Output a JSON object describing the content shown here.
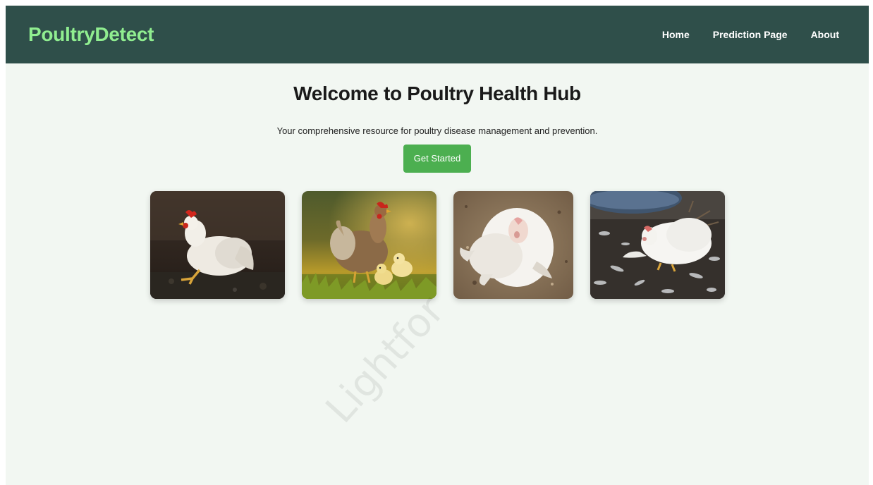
{
  "navbar": {
    "brand": "PoultryDetect",
    "links": [
      "Home",
      "Prediction Page",
      "About"
    ]
  },
  "hero": {
    "title": "Welcome to Poultry Health Hub",
    "subtitle": "Your comprehensive resource for poultry disease management and prevention.",
    "cta_label": "Get Started"
  },
  "gallery": {
    "images": [
      "white-hen-sitting-photo",
      "hen-with-chicks-photo",
      "sick-white-chicken-photo",
      "chicken-on-feathers-photo"
    ]
  },
  "watermark": {
    "text": "Lightfor"
  },
  "colors": {
    "navbar_bg": "#2f4f4a",
    "brand": "#90ee90",
    "page_bg": "#f2f7f2",
    "cta_bg": "#4caf50"
  }
}
